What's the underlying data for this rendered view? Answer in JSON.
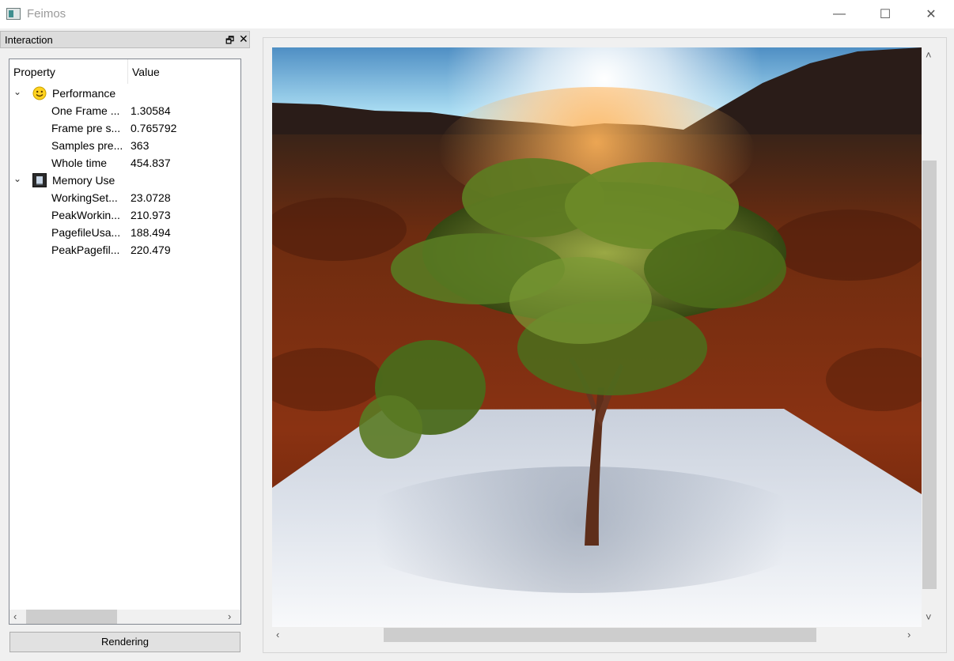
{
  "window": {
    "title": "Feimos",
    "minimize_glyph": "—",
    "maximize_glyph": "☐",
    "close_glyph": "✕"
  },
  "dock": {
    "title": "Interaction",
    "float_glyph": "🗗",
    "close_glyph": "✕"
  },
  "tree": {
    "columns": {
      "property": "Property",
      "value": "Value"
    },
    "categories": [
      {
        "label": "Performance",
        "icon": "smiley-icon",
        "items": [
          {
            "key": "One Frame ...",
            "value": "1.30584"
          },
          {
            "key": "Frame pre s...",
            "value": "0.765792"
          },
          {
            "key": "Samples pre...",
            "value": "363"
          },
          {
            "key": "Whole time",
            "value": "454.837"
          }
        ]
      },
      {
        "label": "Memory Use",
        "icon": "memory-chip-icon",
        "items": [
          {
            "key": "WorkingSet...",
            "value": "23.0728"
          },
          {
            "key": "PeakWorkin...",
            "value": "210.973"
          },
          {
            "key": "PagefileUsa...",
            "value": "188.494"
          },
          {
            "key": "PeakPagefil...",
            "value": "220.479"
          }
        ]
      }
    ]
  },
  "buttons": {
    "rendering": "Rendering"
  },
  "scroll_glyphs": {
    "left": "‹",
    "right": "›",
    "up": "˄",
    "down": "˅",
    "expand": "⌄"
  },
  "colors": {
    "accent_sky": "#8fd0ee",
    "ground": "#7a2a0e",
    "plane": "#dfe4ec",
    "foliage": "#5a7a22"
  }
}
